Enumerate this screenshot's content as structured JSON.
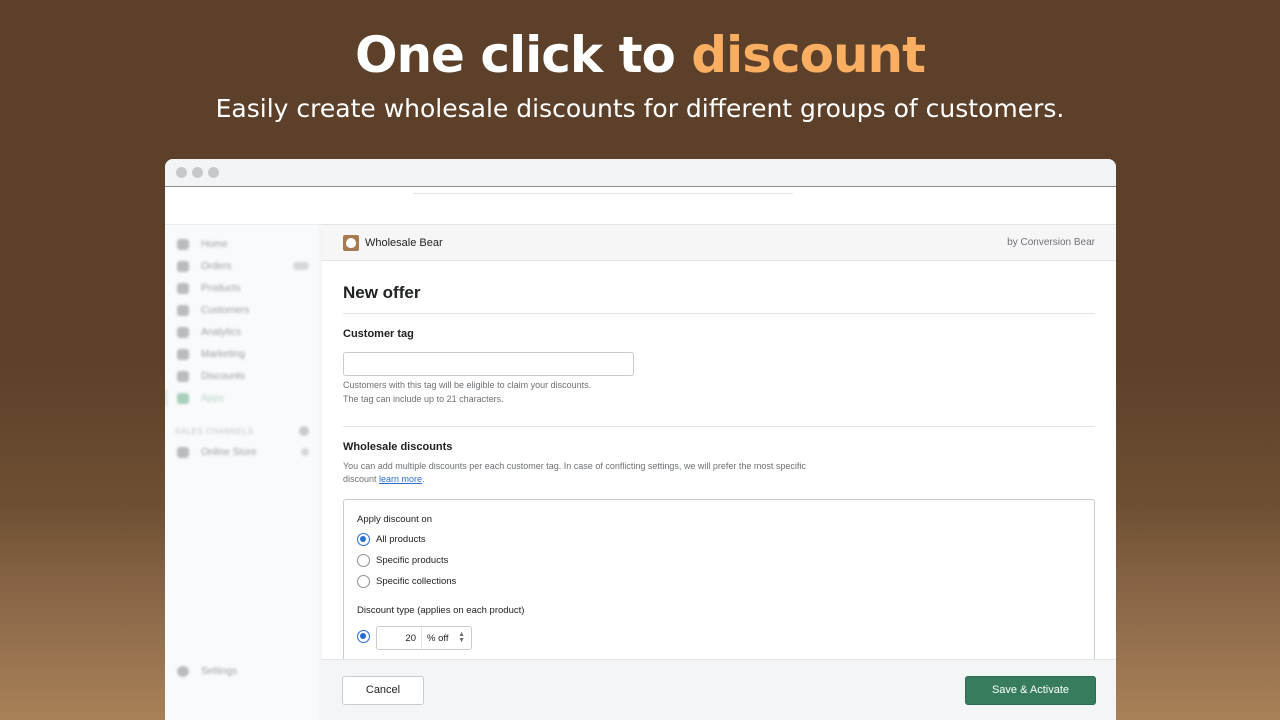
{
  "hero": {
    "headline_main": "One click to",
    "headline_accent": "discount",
    "subheadline": "Easily create wholesale discounts for different groups of customers.",
    "accent_color": "#f9ae62"
  },
  "sidebar": {
    "items": [
      {
        "label": "Home",
        "icon": "home-icon"
      },
      {
        "label": "Orders",
        "icon": "orders-icon",
        "badge": "155"
      },
      {
        "label": "Products",
        "icon": "tag-icon"
      },
      {
        "label": "Customers",
        "icon": "person-icon"
      },
      {
        "label": "Analytics",
        "icon": "bar-chart-icon"
      },
      {
        "label": "Marketing",
        "icon": "megaphone-icon"
      },
      {
        "label": "Discounts",
        "icon": "discount-icon"
      },
      {
        "label": "Apps",
        "icon": "apps-icon",
        "active": true
      }
    ],
    "sales_channels_label": "SALES CHANNELS",
    "online_store_label": "Online Store",
    "settings_label": "Settings"
  },
  "app": {
    "name": "Wholesale Bear",
    "by": "by Conversion Bear",
    "logo_icon": "bear-logo-icon"
  },
  "form": {
    "title": "New offer",
    "customer_tag": {
      "label": "Customer tag",
      "value": "",
      "placeholder": "",
      "help_line1": "Customers with this tag will be eligible to claim your discounts.",
      "help_line2": "The tag can include up to 21 characters."
    },
    "wholesale": {
      "label": "Wholesale discounts",
      "description": "You can add multiple discounts per each customer tag. In case of conflicting settings, we will prefer the most specific discount ",
      "learn_more": "learn more",
      "after_link": "."
    },
    "apply_on": {
      "label": "Apply discount on",
      "options": [
        "All products",
        "Specific products",
        "Specific collections"
      ],
      "selected": "All products"
    },
    "discount_type": {
      "label": "Discount type (applies on each product)",
      "amount": "20",
      "unit": "% off"
    }
  },
  "footer": {
    "cancel_label": "Cancel",
    "save_label": "Save & Activate",
    "save_color": "#367c5d"
  }
}
